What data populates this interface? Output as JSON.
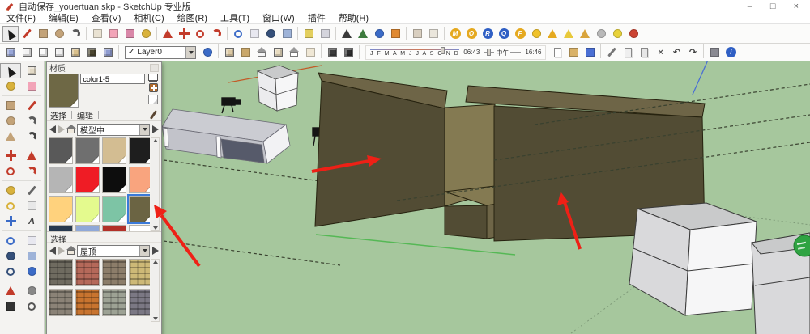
{
  "window": {
    "title": "自动保存_youertuan.skp - SketchUp 专业版",
    "controls": {
      "minimize": "–",
      "maximize": "□",
      "close": "×"
    }
  },
  "menu": {
    "items": [
      "文件(F)",
      "编辑(E)",
      "查看(V)",
      "相机(C)",
      "绘图(R)",
      "工具(T)",
      "窗口(W)",
      "插件",
      "帮助(H)"
    ]
  },
  "toolbar_top": {
    "icons": [
      {
        "n": "select-tool-icon",
        "s": "cursor",
        "c": "#1a1a1a",
        "pressed": true
      },
      {
        "n": "line-tool-icon",
        "s": "bar",
        "c": "#c23b2a"
      },
      {
        "n": "rectangle-tool-icon",
        "s": "sq",
        "c": "#c3a379"
      },
      {
        "n": "circle-tool-icon",
        "s": "ci",
        "c": "#c3a379"
      },
      {
        "n": "arc-tool-icon",
        "s": "arc",
        "c": "#5a5a5a"
      },
      "sep",
      {
        "n": "polygon-tool-icon",
        "s": "sq",
        "c": "#e9e2d2"
      },
      {
        "n": "eraser-tool-icon",
        "s": "sq",
        "c": "#f2a4b8"
      },
      {
        "n": "texture-position-icon",
        "s": "sq",
        "c": "#d987a8"
      },
      {
        "n": "paint-bucket-icon",
        "s": "ci",
        "c": "#d9b23c"
      },
      "sep",
      {
        "n": "push-pull-tool-icon",
        "s": "tri",
        "c": "#c23b2a"
      },
      {
        "n": "move-tool-icon",
        "s": "plus",
        "c": "#c23b2a"
      },
      {
        "n": "rotate-tool-icon",
        "s": "ring",
        "c": "#c23b2a"
      },
      {
        "n": "follow-me-tool-icon",
        "s": "arc",
        "c": "#c23b2a"
      },
      "sep",
      {
        "n": "orbit-tool-icon",
        "s": "ring",
        "c": "#3b6bc7"
      },
      {
        "n": "pan-tool-icon",
        "s": "sq",
        "c": "#e8e8f0"
      },
      {
        "n": "zoom-tool-icon",
        "s": "ci",
        "c": "#35507a"
      },
      {
        "n": "zoom-extents-icon",
        "s": "sq",
        "c": "#9eb3d8"
      },
      "sep",
      {
        "n": "materials-browser-icon",
        "s": "sq",
        "c": "#e3cf5e"
      },
      {
        "n": "components-browser-icon",
        "s": "sq",
        "c": "#d4d4dc"
      },
      "sep",
      {
        "n": "figure-component-icon",
        "s": "tri",
        "c": "#3a3a3a"
      },
      {
        "n": "axes-figure-icon",
        "s": "tri",
        "c": "#3d7a3d"
      },
      {
        "n": "geo-location-icon",
        "s": "ci",
        "c": "#3b6bc7"
      },
      {
        "n": "photo-textures-icon",
        "s": "sq",
        "c": "#e08a33"
      },
      "sep",
      {
        "n": "sandbox-plugin-icon",
        "s": "sq",
        "c": "#d9cfc0"
      },
      {
        "n": "sandbox-plugin-icon-2",
        "s": "sq",
        "c": "#eae6dc"
      },
      "sep",
      {
        "n": "plugin-m-coin-icon",
        "s": "letter",
        "c": "#e5a91f",
        "t": "M"
      },
      {
        "n": "plugin-o-coin-icon",
        "s": "letter",
        "c": "#e5a91f",
        "t": "O"
      },
      {
        "n": "plugin-r-coin-icon",
        "s": "letter",
        "c": "#2f5fc4",
        "t": "R"
      },
      {
        "n": "plugin-q-coin-icon",
        "s": "letter",
        "c": "#2f5fc4",
        "t": "Q"
      },
      {
        "n": "plugin-f-coin-icon",
        "s": "letter",
        "c": "#e5a91f",
        "t": "F"
      },
      {
        "n": "yellow-ball-plugin-icon",
        "s": "ci",
        "c": "#f0c22a"
      },
      {
        "n": "arrow-up-plugin-icon",
        "s": "tri",
        "c": "#e5a91f"
      },
      {
        "n": "flag-plugin-icon",
        "s": "tri",
        "c": "#e8c93a"
      },
      {
        "n": "cone-plugin-icon",
        "s": "tri",
        "c": "#d9a43c"
      },
      {
        "n": "gray-ball-plugin-icon",
        "s": "ci",
        "c": "#b9b9b9"
      },
      {
        "n": "burst-plugin-icon",
        "s": "ci",
        "c": "#e8d23a"
      },
      {
        "n": "color-wheel-plugin-icon",
        "s": "ci",
        "c": "#cc4433"
      }
    ]
  },
  "toolbar_second": {
    "style_icons": [
      {
        "n": "xray-style-icon",
        "s": "cube",
        "c": "#98a6d8"
      },
      {
        "n": "wireframe-style-icon",
        "s": "cube",
        "c": "#f2f2f2"
      },
      {
        "n": "hidden-line-style-icon",
        "s": "cube",
        "c": "#fafafa"
      },
      {
        "n": "shaded-style-icon",
        "s": "cube",
        "c": "#efefef"
      },
      {
        "n": "shaded-textures-style-icon",
        "s": "cube",
        "c": "#d9c08c"
      },
      {
        "n": "monochrome-style-icon",
        "s": "cube",
        "c": "#4a452f"
      },
      {
        "n": "back-edges-style-icon",
        "s": "cube",
        "c": "#8f9cd0"
      }
    ],
    "layer": {
      "check": "✓",
      "value": "Layer0"
    },
    "after_layer_icons": [
      {
        "n": "layer-manager-icon",
        "s": "ci",
        "c": "#3b6bc7"
      },
      "sep",
      {
        "n": "component-box-icon",
        "s": "cube",
        "c": "#dcc9a4"
      },
      {
        "n": "door-component-icon",
        "s": "sq",
        "c": "#c9a76a"
      },
      {
        "n": "house-component-icon",
        "s": "house",
        "c": "#f5f5f5"
      },
      {
        "n": "roof-component-icon",
        "s": "cube",
        "c": "#e8dcc0"
      },
      {
        "n": "house-outline-icon",
        "s": "house",
        "c": "#ffffff"
      },
      {
        "n": "slab-component-icon",
        "s": "sq",
        "c": "#efe7d5"
      },
      "sep",
      {
        "n": "dark-component-icon",
        "s": "cube",
        "c": "#3a3a3a"
      },
      {
        "n": "dark-component-info-icon",
        "s": "cube",
        "c": "#2f2f2f"
      }
    ],
    "shadow": {
      "months": "J F M A M J J A S O N D",
      "start_time": "06:43",
      "noon_label": "中午",
      "end_time": "16:46"
    },
    "file_icons": [
      {
        "n": "new-file-icon",
        "s": "page",
        "c": "#ffffff"
      },
      {
        "n": "open-file-icon",
        "s": "sq",
        "c": "#d9b268"
      },
      {
        "n": "save-file-icon",
        "s": "sq",
        "c": "#4a6fd4"
      },
      "sep",
      {
        "n": "cut-icon",
        "s": "bar",
        "c": "#777777"
      },
      {
        "n": "copy-icon",
        "s": "page",
        "c": "#efefef"
      },
      {
        "n": "paste-icon",
        "s": "page",
        "c": "#e6e6e6"
      },
      {
        "n": "delete-icon",
        "s": "glyph",
        "c": "#555555",
        "t": "×"
      },
      {
        "n": "undo-icon",
        "s": "glyph",
        "c": "#444444",
        "t": "↶"
      },
      {
        "n": "redo-icon",
        "s": "glyph",
        "c": "#444444",
        "t": "↷"
      },
      "sep",
      {
        "n": "print-icon",
        "s": "sq",
        "c": "#8a8a92"
      },
      {
        "n": "model-info-icon",
        "s": "letter",
        "c": "#2f5fc4",
        "t": "i"
      }
    ]
  },
  "left_toolbar": {
    "icons": [
      {
        "n": "select-tool-icon",
        "s": "cursor",
        "c": "#1a1a1a",
        "pressed": true
      },
      {
        "n": "make-component-icon",
        "s": "cube",
        "c": "#e2d9c6"
      },
      {
        "n": "paint-bucket-icon",
        "s": "ci",
        "c": "#d9b23c"
      },
      {
        "n": "eraser-tool-icon",
        "s": "sq",
        "c": "#f2a4b8"
      },
      "sep",
      {
        "n": "rectangle-tool-icon",
        "s": "sq",
        "c": "#c3a379"
      },
      {
        "n": "line-tool-icon",
        "s": "bar",
        "c": "#c23b2a"
      },
      {
        "n": "circle-tool-icon",
        "s": "ci",
        "c": "#c3a379"
      },
      {
        "n": "arc-tool-icon",
        "s": "arc",
        "c": "#5a5a5a"
      },
      {
        "n": "polygon-tool-icon",
        "s": "tri",
        "c": "#c3a379"
      },
      {
        "n": "freehand-tool-icon",
        "s": "arc",
        "c": "#444444"
      },
      "sep",
      {
        "n": "move-tool-icon",
        "s": "plus",
        "c": "#c23b2a"
      },
      {
        "n": "push-pull-tool-icon",
        "s": "tri",
        "c": "#c23b2a"
      },
      {
        "n": "rotate-tool-icon",
        "s": "ring",
        "c": "#c23b2a"
      },
      {
        "n": "offset-tool-icon",
        "s": "arc",
        "c": "#c23b2a"
      },
      "sep",
      {
        "n": "tape-measure-icon",
        "s": "ci",
        "c": "#d9b23c"
      },
      {
        "n": "dimension-tool-icon",
        "s": "bar",
        "c": "#666666"
      },
      {
        "n": "protractor-icon",
        "s": "ring",
        "c": "#d9b23c"
      },
      {
        "n": "text-tool-icon",
        "s": "sq",
        "c": "#e8e8e8"
      },
      {
        "n": "axes-tool-icon",
        "s": "plus",
        "c": "#3b6bc7"
      },
      {
        "n": "threed-text-icon",
        "s": "glyph",
        "c": "#444444",
        "t": "A"
      },
      "sep",
      {
        "n": "orbit-tool-icon",
        "s": "ring",
        "c": "#3b6bc7"
      },
      {
        "n": "pan-tool-icon",
        "s": "sq",
        "c": "#e8e8f0"
      },
      {
        "n": "zoom-tool-icon",
        "s": "ci",
        "c": "#35507a"
      },
      {
        "n": "zoom-extents-icon",
        "s": "sq",
        "c": "#9eb3d8"
      },
      {
        "n": "zoom-window-icon",
        "s": "ring",
        "c": "#35507a"
      },
      {
        "n": "previous-view-icon",
        "s": "ci",
        "c": "#3b6bc7"
      },
      "sep",
      {
        "n": "position-camera-icon",
        "s": "tri",
        "c": "#c23b2a"
      },
      {
        "n": "look-around-icon",
        "s": "ci",
        "c": "#888888"
      },
      {
        "n": "walk-tool-icon",
        "s": "sq",
        "c": "#333333"
      },
      {
        "n": "turn-tool-icon",
        "s": "ring",
        "c": "#555555"
      }
    ]
  },
  "materials_panel": {
    "title": "材质",
    "preview_color": "#6e6845",
    "name_value": "color1-5",
    "tabs": [
      "选择",
      "编辑"
    ],
    "in_model_dropdown": "模型中",
    "swatches": [
      {
        "c": "#595959"
      },
      {
        "c": "#6f6f6f"
      },
      {
        "c": "#d3bd92"
      },
      {
        "c": "#1e1e1e"
      },
      {
        "c": "#b5b5b5"
      },
      {
        "c": "#ef1c25"
      },
      {
        "c": "#0d0d0d"
      },
      {
        "c": "#f9a47e"
      },
      {
        "c": "#ffd27d"
      },
      {
        "c": "#e4fa8e"
      },
      {
        "c": "#7dc4a5"
      },
      {
        "c": "#6b6443",
        "selected": true
      },
      {
        "c": "#27394f"
      },
      {
        "c": "#8fa8d8"
      },
      {
        "c": "#b23028"
      },
      {
        "c": "#ffffff"
      }
    ],
    "section2_label": "选择",
    "library_dropdown": "屋顶",
    "textures": [
      {
        "n": "slate-shingles-texture",
        "c": "#6f6b60"
      },
      {
        "n": "red-shingles-texture",
        "c": "#b5695a"
      },
      {
        "n": "gray-tile-texture",
        "c": "#8c7d6a"
      },
      {
        "n": "thatch-texture",
        "c": "#cdb977"
      },
      {
        "n": "brown-shingles-texture",
        "c": "#8b8377"
      },
      {
        "n": "barrel-tile-texture",
        "c": "#c8742f"
      },
      {
        "n": "concrete-roof-texture",
        "c": "#9da294"
      },
      {
        "n": "purple-slate-texture",
        "c": "#7b7884"
      }
    ]
  },
  "viewport": {
    "colors": {
      "ground": "#a6c79d",
      "edge": "#26220f",
      "box_front": "#524c34",
      "box_top": "#6e6547",
      "box_inner": "#847a52",
      "step_front": "#6e6547",
      "axis_red": "#c35b28",
      "axis_green": "#55b855",
      "axis_blue": "#4a6fd4",
      "dash": "#39412f",
      "dot_guide": "#7e9a78",
      "slab_top": "#cbccd2",
      "slab_front": "#c2c3ca",
      "slab_end": "#f2f2f4",
      "slab_recess": "#565a6a",
      "white_face": "#f6f6f7",
      "gray_face": "#d9d9db",
      "top_face": "#c9cacb",
      "annotation_red": "#ee2016",
      "badge_green": "#2fa342",
      "equipment_black": "#141414"
    }
  }
}
